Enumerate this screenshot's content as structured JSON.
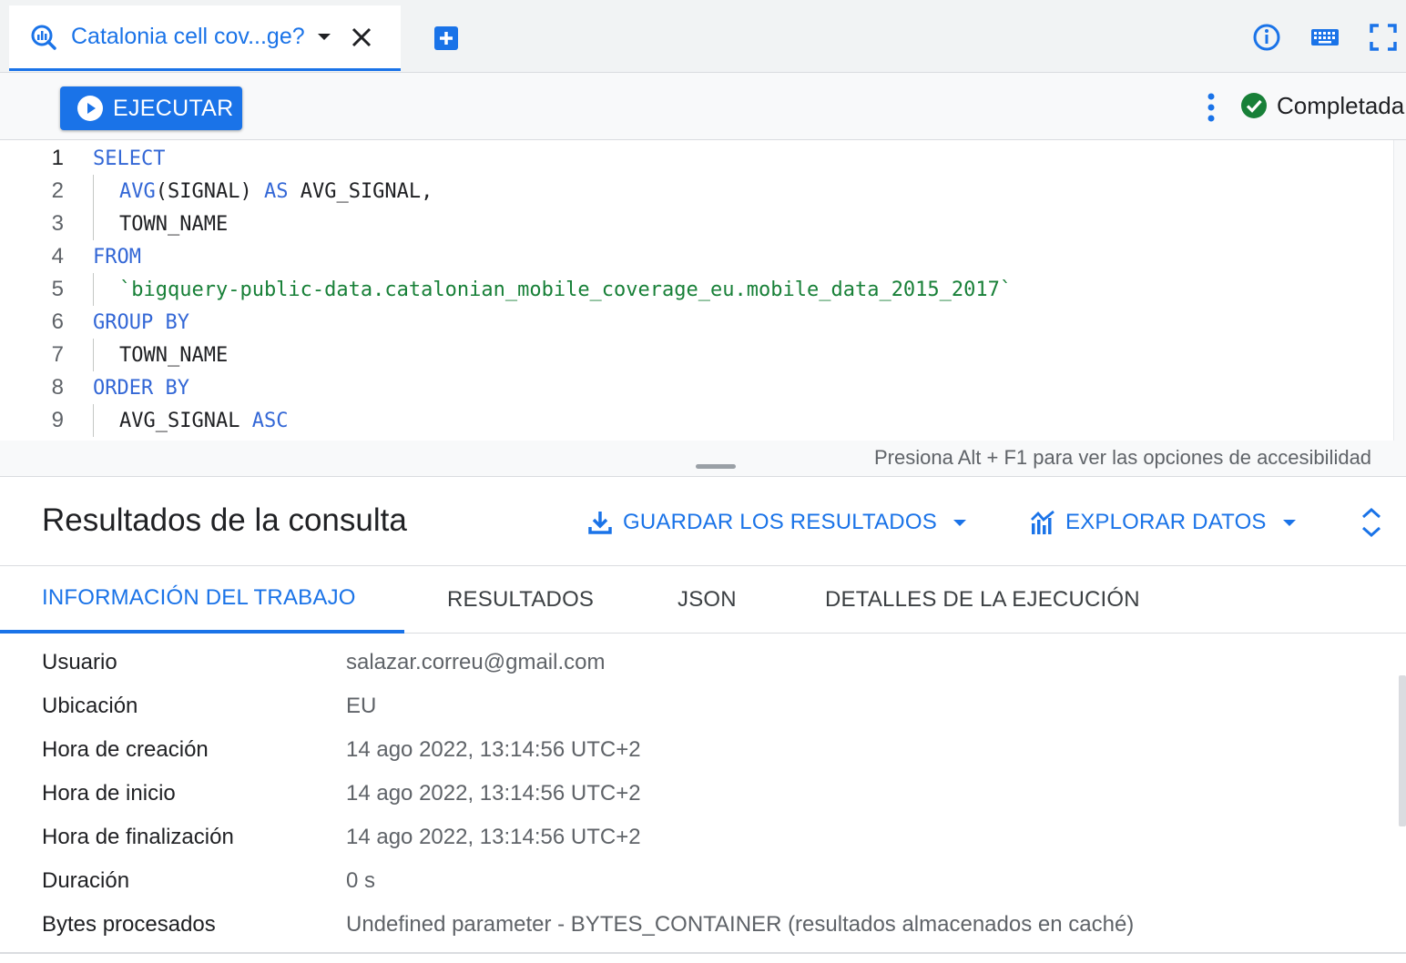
{
  "tab": {
    "title": "Catalonia cell cov...ge?",
    "icons": [
      "query-icon",
      "chevron-down-icon",
      "close-icon",
      "add-tab-icon"
    ]
  },
  "top_icons": [
    "info-icon",
    "keyboard-icon",
    "fullscreen-icon"
  ],
  "toolbar": {
    "run_label": "EJECUTAR",
    "status_label": "Completada"
  },
  "editor": {
    "lines": [
      {
        "num": "1",
        "tokens": [
          {
            "t": "SELECT",
            "k": "kw"
          }
        ]
      },
      {
        "num": "2",
        "indent": true,
        "tokens": [
          {
            "t": "AVG",
            "k": "kw"
          },
          {
            "t": "(SIGNAL) ",
            "k": ""
          },
          {
            "t": "AS",
            "k": "kw"
          },
          {
            "t": " AVG_SIGNAL,",
            "k": ""
          }
        ]
      },
      {
        "num": "3",
        "indent": true,
        "tokens": [
          {
            "t": "TOWN_NAME",
            "k": ""
          }
        ]
      },
      {
        "num": "4",
        "tokens": [
          {
            "t": "FROM",
            "k": "kw"
          }
        ]
      },
      {
        "num": "5",
        "indent": true,
        "tokens": [
          {
            "t": "`bigquery-public-data.catalonian_mobile_coverage_eu.mobile_data_2015_2017`",
            "k": "str"
          }
        ]
      },
      {
        "num": "6",
        "tokens": [
          {
            "t": "GROUP BY",
            "k": "kw"
          }
        ]
      },
      {
        "num": "7",
        "indent": true,
        "tokens": [
          {
            "t": "TOWN_NAME",
            "k": ""
          }
        ]
      },
      {
        "num": "8",
        "tokens": [
          {
            "t": "ORDER BY",
            "k": "kw"
          }
        ]
      },
      {
        "num": "9",
        "indent": true,
        "tokens": [
          {
            "t": "AVG_SIGNAL ",
            "k": ""
          },
          {
            "t": "ASC",
            "k": "kw"
          }
        ]
      }
    ],
    "a11y_hint": "Presiona Alt + F1 para ver las opciones de accesibilidad"
  },
  "results": {
    "title": "Resultados de la consulta",
    "save_label": "GUARDAR LOS RESULTADOS",
    "explore_label": "EXPLORAR DATOS",
    "tabs": [
      "INFORMACIÓN DEL TRABAJO",
      "RESULTADOS",
      "JSON",
      "DETALLES DE LA EJECUCIÓN"
    ],
    "active_tab": 0
  },
  "job_info": [
    {
      "key": "Usuario",
      "value": "salazar.correu@gmail.com"
    },
    {
      "key": "Ubicación",
      "value": "EU"
    },
    {
      "key": "Hora de creación",
      "value": "14 ago 2022, 13:14:56 UTC+2"
    },
    {
      "key": "Hora de inicio",
      "value": "14 ago 2022, 13:14:56 UTC+2"
    },
    {
      "key": "Hora de finalización",
      "value": "14 ago 2022, 13:14:56 UTC+2"
    },
    {
      "key": "Duración",
      "value": "0 s"
    },
    {
      "key": "Bytes procesados",
      "value": "Undefined parameter - BYTES_CONTAINER (resultados almacenados en caché)"
    }
  ],
  "colors": {
    "accent": "#1a73e8",
    "keyword": "#3367d6",
    "string": "#188038",
    "success": "#188038"
  }
}
